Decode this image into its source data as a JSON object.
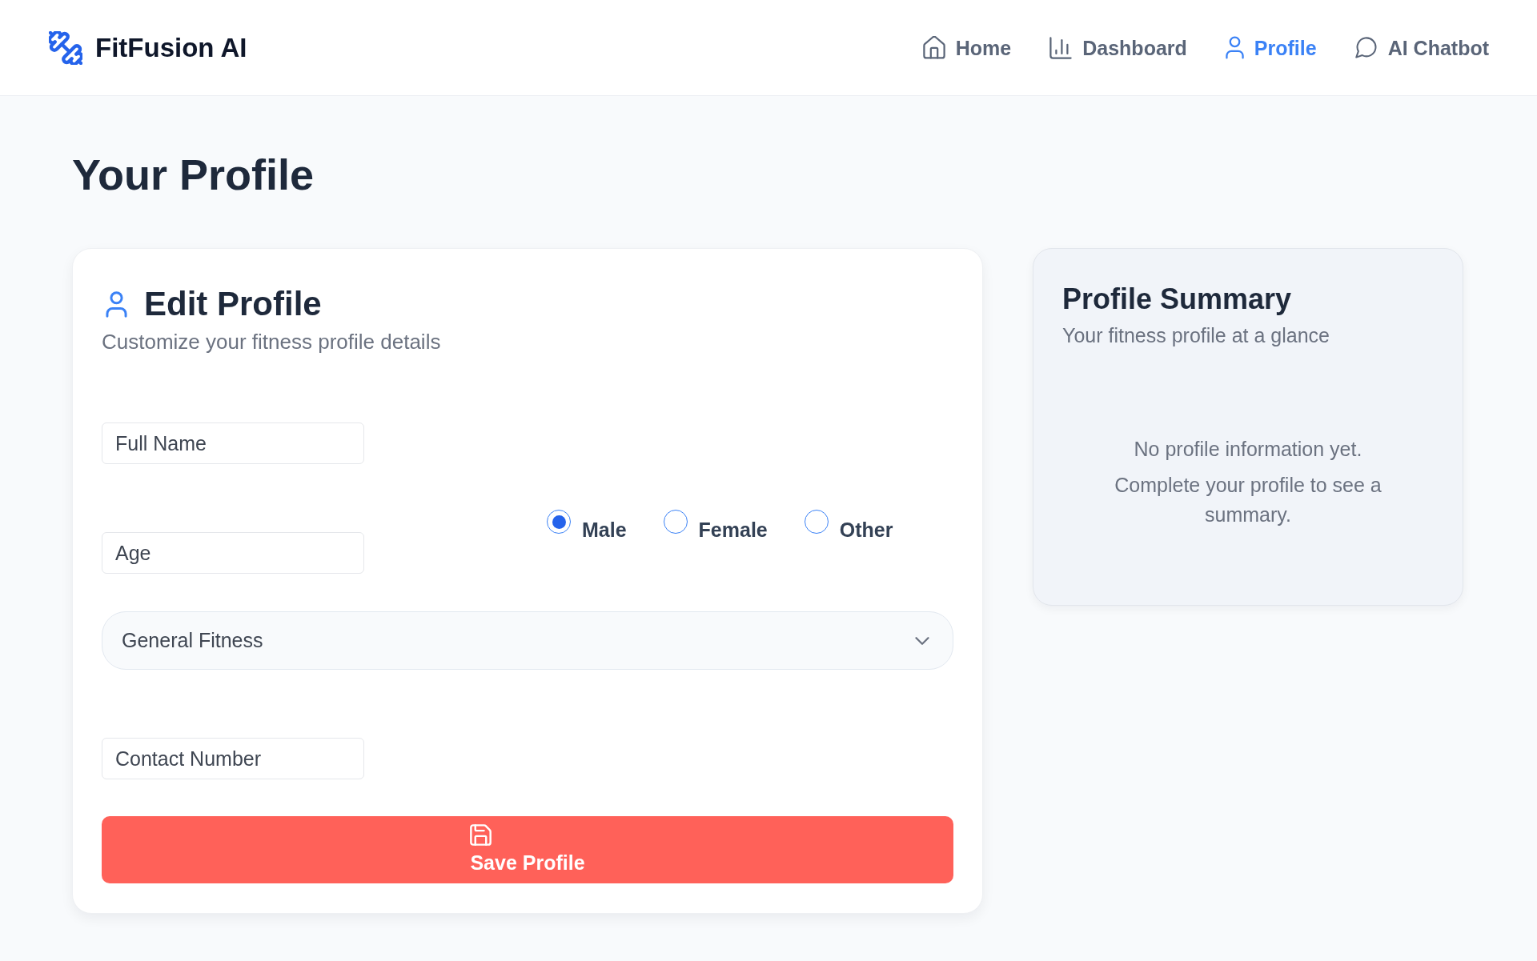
{
  "header": {
    "app_name": "FitFusion AI",
    "nav": [
      {
        "label": "Home",
        "selected": false
      },
      {
        "label": "Dashboard",
        "selected": false
      },
      {
        "label": "Profile",
        "selected": true
      },
      {
        "label": "AI Chatbot",
        "selected": false
      }
    ]
  },
  "page_title": "Your Profile",
  "edit_profile": {
    "title": "Edit Profile",
    "subtitle": "Customize your fitness profile details",
    "full_name": {
      "placeholder": "Full Name"
    },
    "age": {
      "placeholder": "Age"
    },
    "gender_options": [
      {
        "label": "Male",
        "selected": true
      },
      {
        "label": "Female",
        "selected": false
      },
      {
        "label": "Other",
        "selected": false
      }
    ],
    "fitness_goal": {
      "value": "General Fitness"
    },
    "contact_number": {
      "placeholder": "Contact Number"
    },
    "save_button": "Save Profile"
  },
  "profile_summary": {
    "title": "Profile Summary",
    "subtitle": "Your fitness profile at a glance",
    "empty_messages": [
      "No profile information yet.",
      "Complete your profile to see a summary."
    ]
  }
}
